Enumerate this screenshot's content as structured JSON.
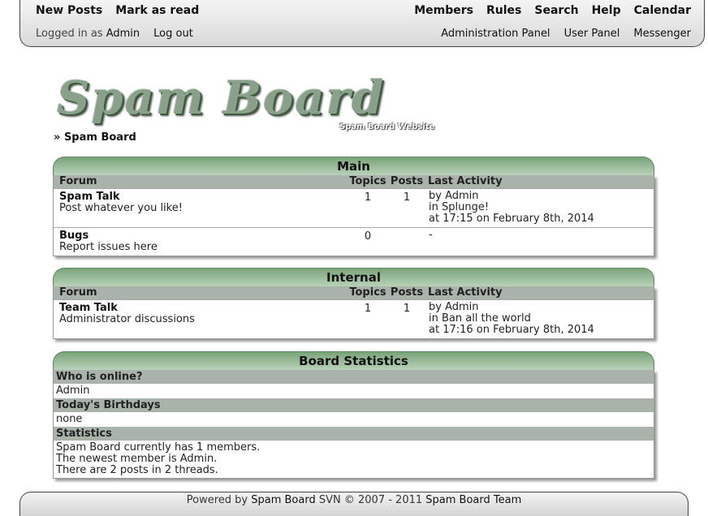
{
  "topbar": {
    "left_links": [
      "New Posts",
      "Mark as read"
    ],
    "right_links": [
      "Members",
      "Rules",
      "Search",
      "Help",
      "Calendar"
    ],
    "logged_in_prefix": "Logged in as",
    "username": "Admin",
    "logout": "Log out",
    "panels": [
      "Administration Panel",
      "User Panel",
      "Messenger"
    ]
  },
  "logo": {
    "title": "Spam Board",
    "tagline": "Spam Board Website"
  },
  "breadcrumb": {
    "prefix": "»",
    "label": "Spam Board"
  },
  "columns": {
    "forum": "Forum",
    "topics": "Topics",
    "posts": "Posts",
    "last": "Last Activity"
  },
  "categories": [
    {
      "title": "Main",
      "forums": [
        {
          "name": "Spam Talk",
          "desc": "Post whatever you like!",
          "topics": "1",
          "posts": "1",
          "last": [
            "by Admin",
            "in Splunge!",
            "at 17:15 on February 8th, 2014"
          ]
        },
        {
          "name": "Bugs",
          "desc": "Report issues here",
          "topics": "0",
          "posts": "",
          "last": [
            "-"
          ]
        }
      ]
    },
    {
      "title": "Internal",
      "forums": [
        {
          "name": "Team Talk",
          "desc": "Administrator discussions",
          "topics": "1",
          "posts": "1",
          "last": [
            "by Admin",
            "in Ban all the world",
            "at 17:16 on February 8th, 2014"
          ]
        }
      ]
    }
  ],
  "stats": {
    "title": "Board Statistics",
    "online_h": "Who is online?",
    "online_v": "Admin",
    "bday_h": "Today's Birthdays",
    "bday_v": "none",
    "stats_h": "Statistics",
    "lines": [
      "Spam Board currently has 1 members.",
      "The newest member is Admin.",
      "There are 2 posts in 2 threads."
    ]
  },
  "footer": {
    "prefix": "Powered by",
    "product": "Spam Board",
    "version": "SVN",
    "copy": "© 2007 - 2011",
    "team": "Spam Board Team"
  }
}
